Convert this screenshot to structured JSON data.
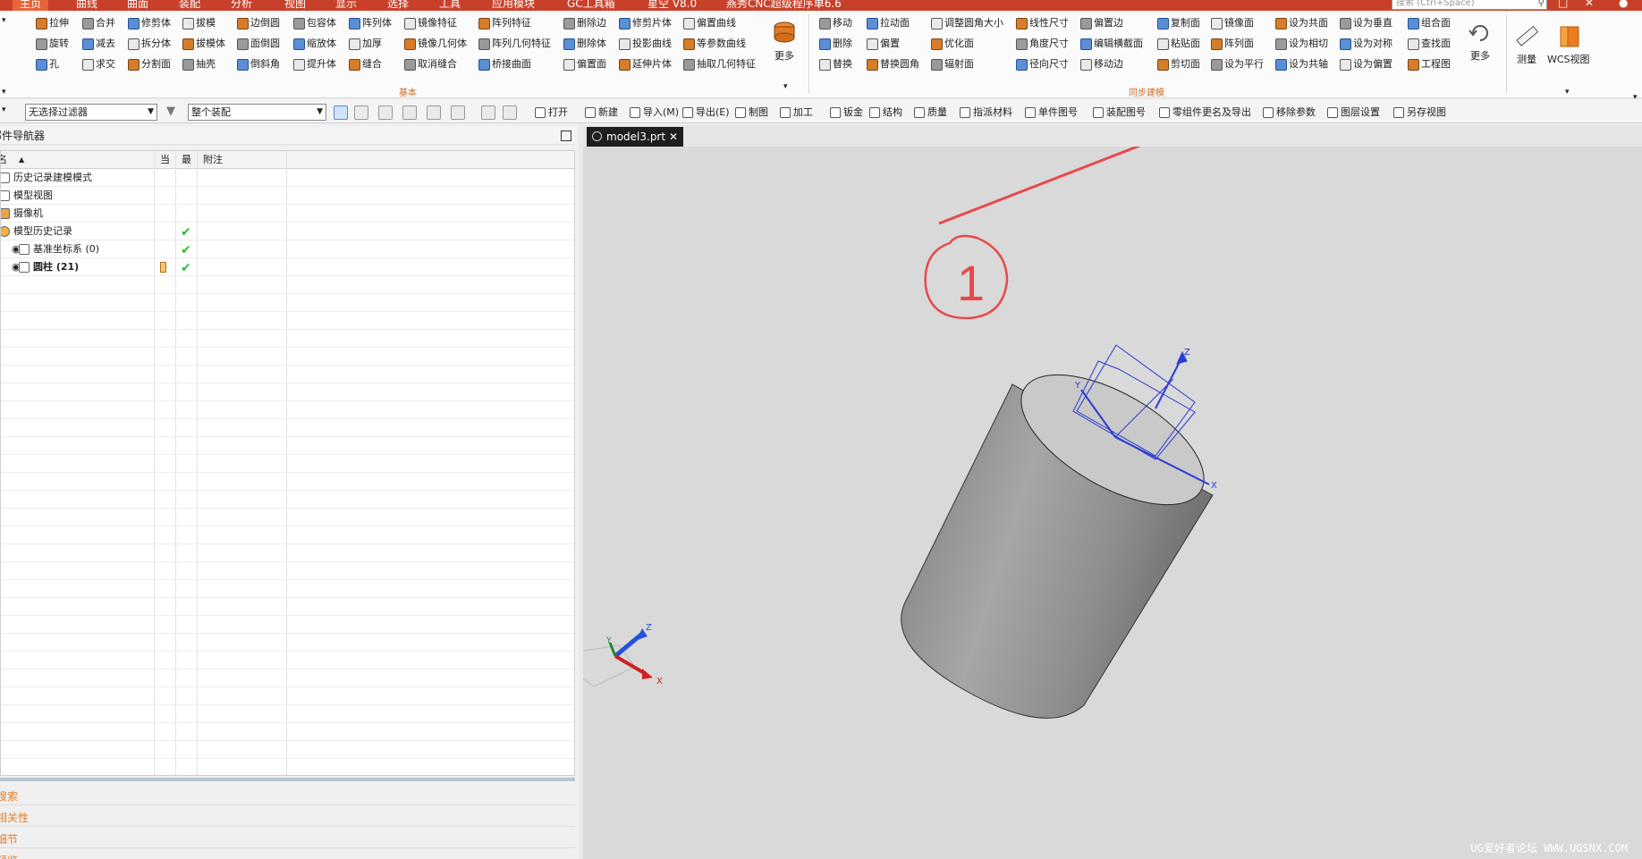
{
  "menubar": {
    "tabs": [
      "主页",
      "曲线",
      "曲面",
      "装配",
      "分析",
      "视图",
      "显示",
      "选择",
      "工具",
      "应用模块",
      "GC工具箱",
      "星空 V8.0",
      "燕秀CNC超级程序单6.6"
    ],
    "active_tab": 0,
    "search_placeholder": "搜索 (Ctrl+Space)"
  },
  "ribbon": {
    "base_group_label": "基本",
    "sync_group_label": "同步建模",
    "base_items": [
      [
        "拉伸",
        "合并",
        "修剪体",
        "拔模",
        "边倒圆",
        "包容体",
        "阵列体",
        "镜像特征",
        "阵列特征",
        "删除边",
        "修剪片体",
        "偏置曲线"
      ],
      [
        "旋转",
        "减去",
        "拆分体",
        "拔模体",
        "面倒圆",
        "缩放体",
        "加厚",
        "镜像几何体",
        "阵列几何特征",
        "删除体",
        "投影曲线",
        "等参数曲线"
      ],
      [
        "孔",
        "求交",
        "分割面",
        "抽壳",
        "倒斜角",
        "提升体",
        "缝合",
        "取消缝合",
        "桥接曲面",
        "偏置面",
        "延伸片体",
        "抽取几何特征"
      ]
    ],
    "sync_items": [
      [
        "移动",
        "拉动面",
        "调整圆角大小",
        "线性尺寸",
        "偏置边",
        "复制面",
        "镜像面",
        "设为共面",
        "设为垂直",
        "组合面"
      ],
      [
        "删除",
        "偏置",
        "优化面",
        "角度尺寸",
        "编辑横截面",
        "粘贴面",
        "阵列面",
        "设为相切",
        "设为对称",
        "查找面"
      ],
      [
        "替换",
        "替换圆角",
        "辐射面",
        "径向尺寸",
        "移动边",
        "剪切面",
        "设为平行",
        "设为共轴",
        "设为偏置",
        "工程图"
      ]
    ],
    "more_label": "更多",
    "measure_label": "测量",
    "wcs_label": "WCS视图"
  },
  "toolbar2": {
    "filter_value": "无选择过滤器",
    "scope_value": "整个装配",
    "items": [
      "打开",
      "新建",
      "导入(M)",
      "导出(E)",
      "制图",
      "加工",
      "钣金",
      "结构",
      "质量",
      "指派材料",
      "单件图号",
      "装配图号",
      "零组件更名及导出",
      "移除参数",
      "图层设置",
      "另存视图"
    ]
  },
  "navigator": {
    "title": "部件导航器",
    "col_name": "名",
    "col_current": "当",
    "col_latest": "最",
    "col_note": "附注",
    "rows": [
      {
        "label": "历史记录建模模式",
        "check": false
      },
      {
        "label": "模型视图",
        "check": false
      },
      {
        "label": "摄像机",
        "check": false
      },
      {
        "label": "模型历史记录",
        "check": true
      },
      {
        "label": "基准坐标系 (0)",
        "check": true
      },
      {
        "label": "圆柱 (21)",
        "check": true
      }
    ],
    "bottom_links": [
      "搜索",
      "相关性",
      "细节",
      "预览"
    ]
  },
  "viewport": {
    "tab_label": "model3.prt",
    "annotation_text": "1",
    "watermark": "UG爱好者论坛  WWW.UGSNX.COM",
    "colors": {
      "annotation": "#e8484b",
      "viewport_bg": "#d9d9d9"
    }
  }
}
